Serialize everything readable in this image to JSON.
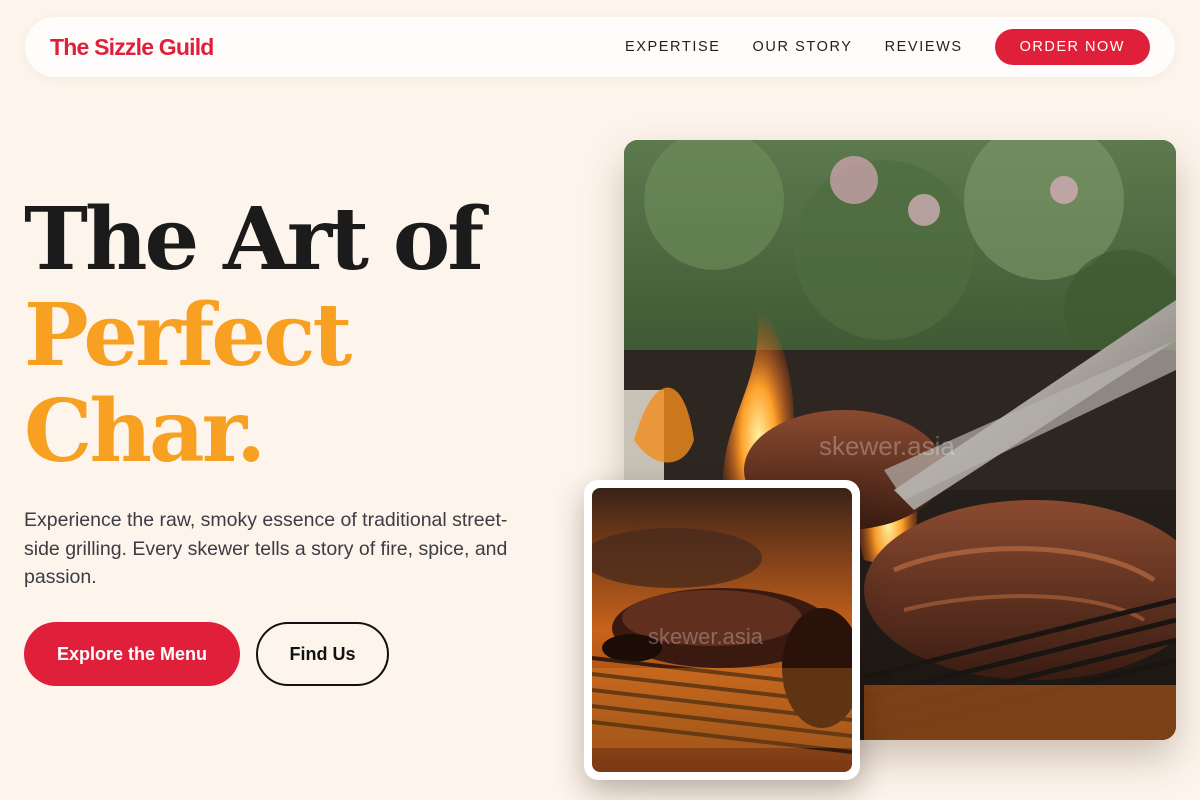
{
  "nav": {
    "brand": "The Sizzle Guild",
    "links": [
      "EXPERTISE",
      "OUR STORY",
      "REVIEWS"
    ],
    "cta": "ORDER NOW"
  },
  "hero": {
    "headline_line1": "The Art of",
    "headline_line2": "Perfect",
    "headline_line3": "Char.",
    "lead": "Experience the raw, smoky essence of traditional street-side grilling. Every skewer tells a story of fire, spice, and passion.",
    "primary_button": "Explore the Menu",
    "secondary_button": "Find Us"
  },
  "images": {
    "main_watermark": "skewer.asia",
    "inset_watermark": "skewer.asia"
  },
  "colors": {
    "brand_red": "#e0203a",
    "accent_orange": "#f7a022",
    "background": "#fdf5ec",
    "text_dark": "#1b1b1b"
  }
}
